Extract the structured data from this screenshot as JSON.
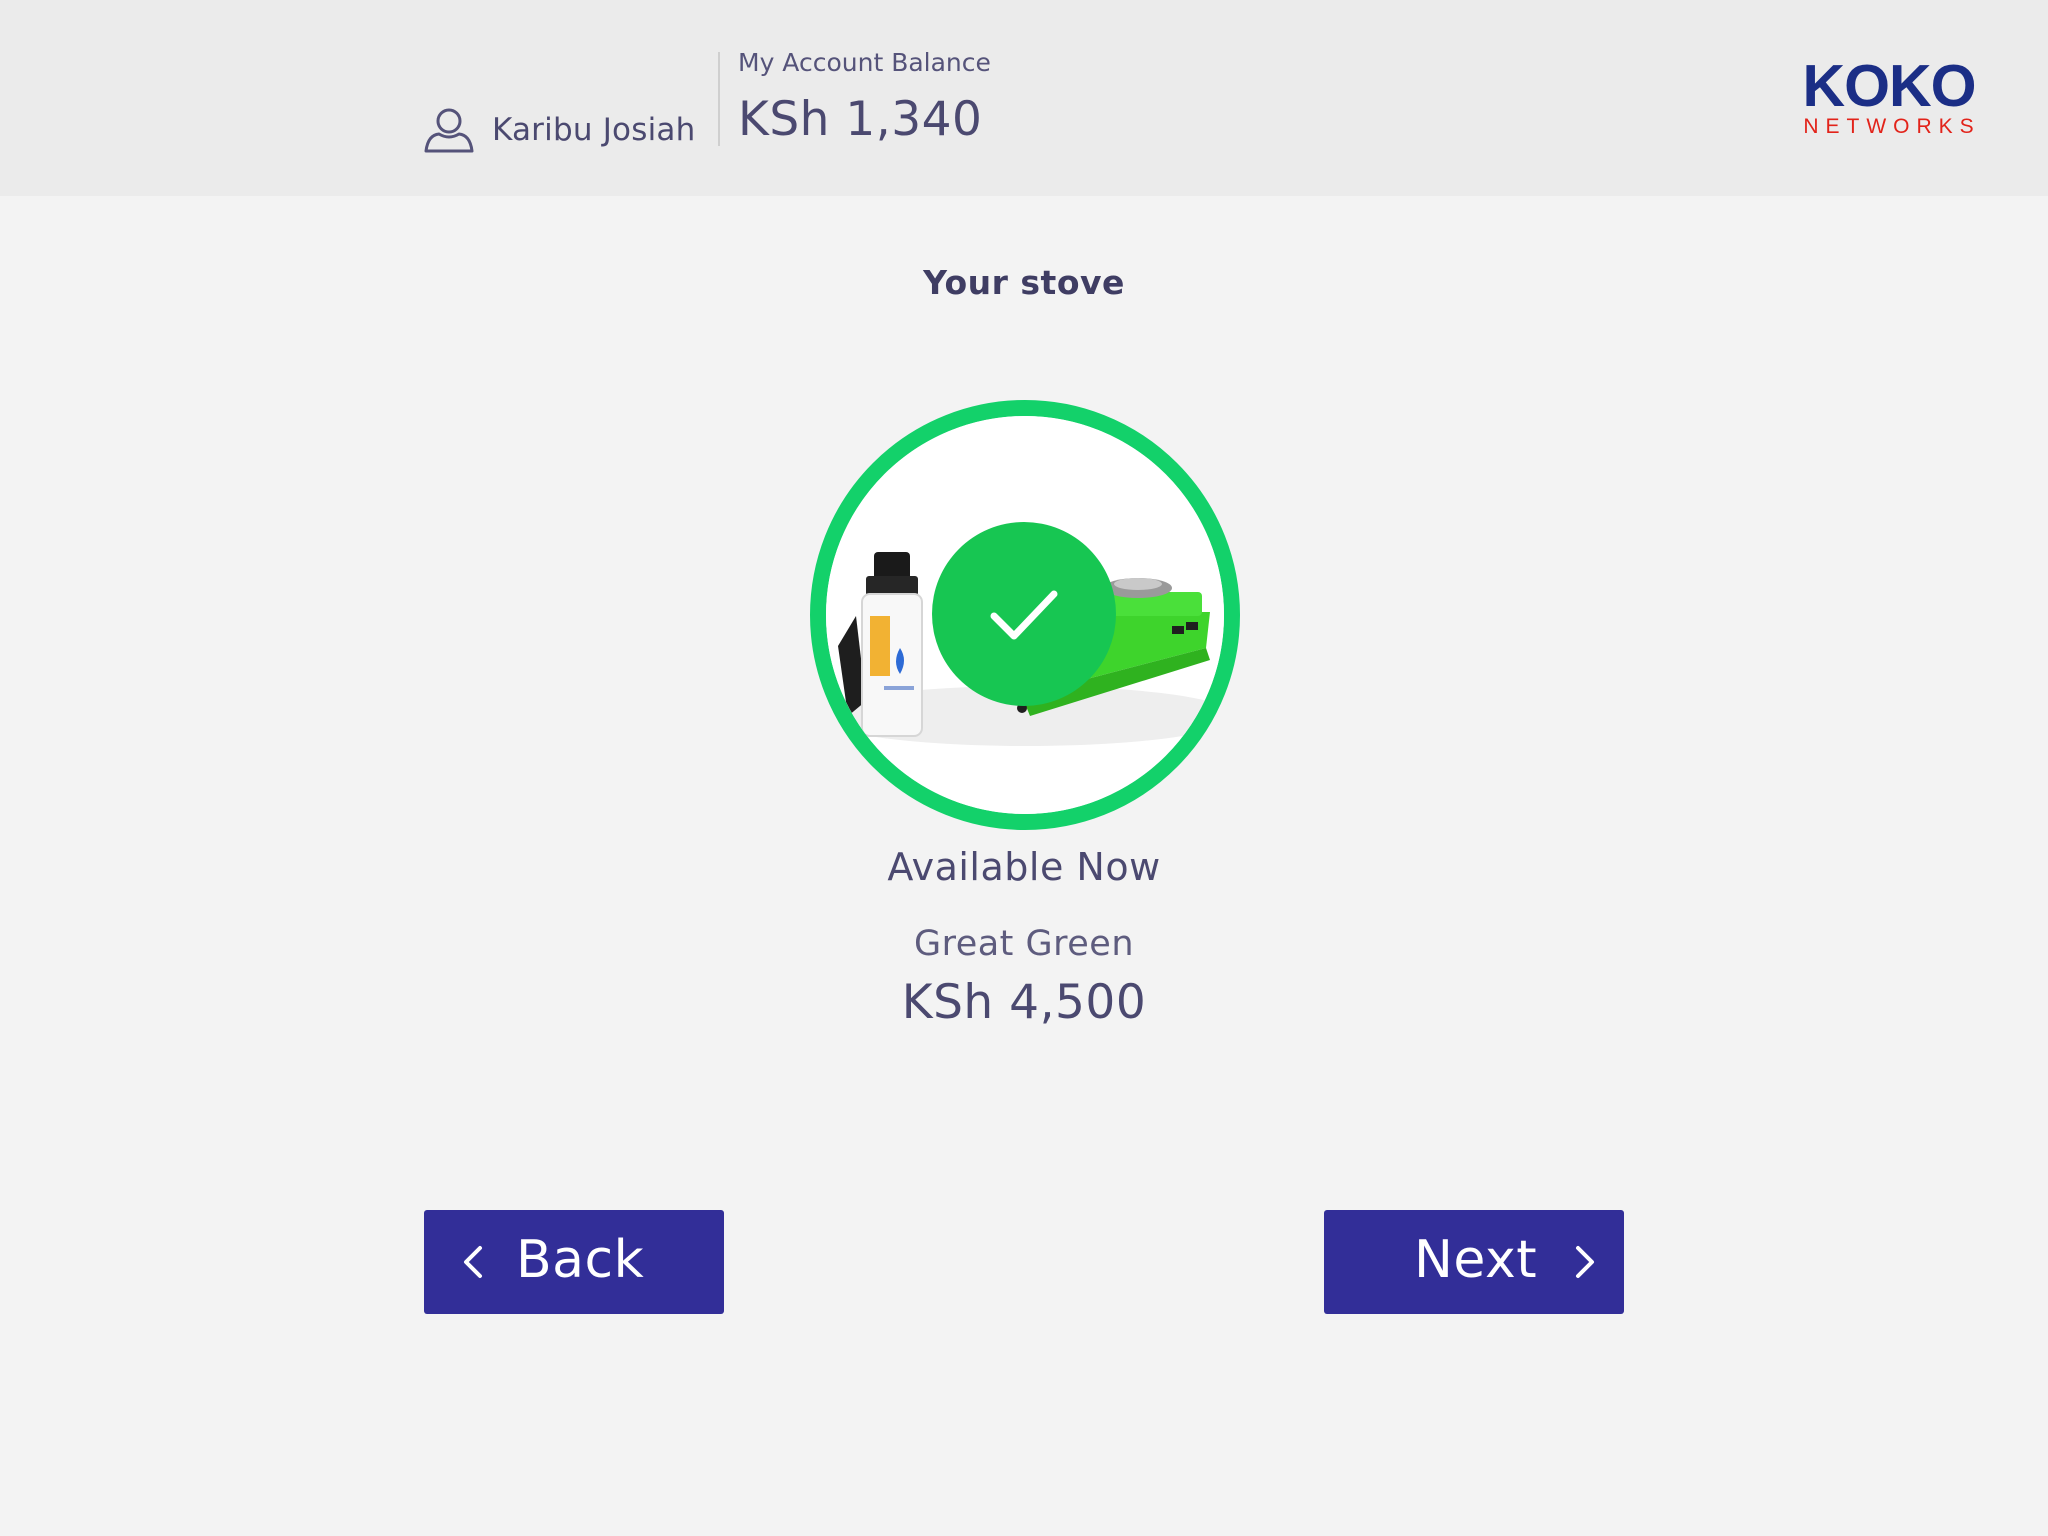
{
  "header": {
    "user_greeting": "Karibu Josiah",
    "user_icon": "user-icon",
    "balance_label": "My Account Balance",
    "balance_value": "KSh 1,340",
    "logo": {
      "main": "KOKO",
      "sub": "NETWORKS",
      "main_color": "#1b2e86",
      "sub_color": "#e2231a"
    }
  },
  "main": {
    "title": "Your stove",
    "status": "Available Now",
    "product_name": "Great Green",
    "product_price": "KSh 4,500",
    "ring_color": "#13d16a",
    "check_color": "#17c652"
  },
  "nav": {
    "back_label": "Back",
    "next_label": "Next",
    "button_color": "#322e98"
  }
}
